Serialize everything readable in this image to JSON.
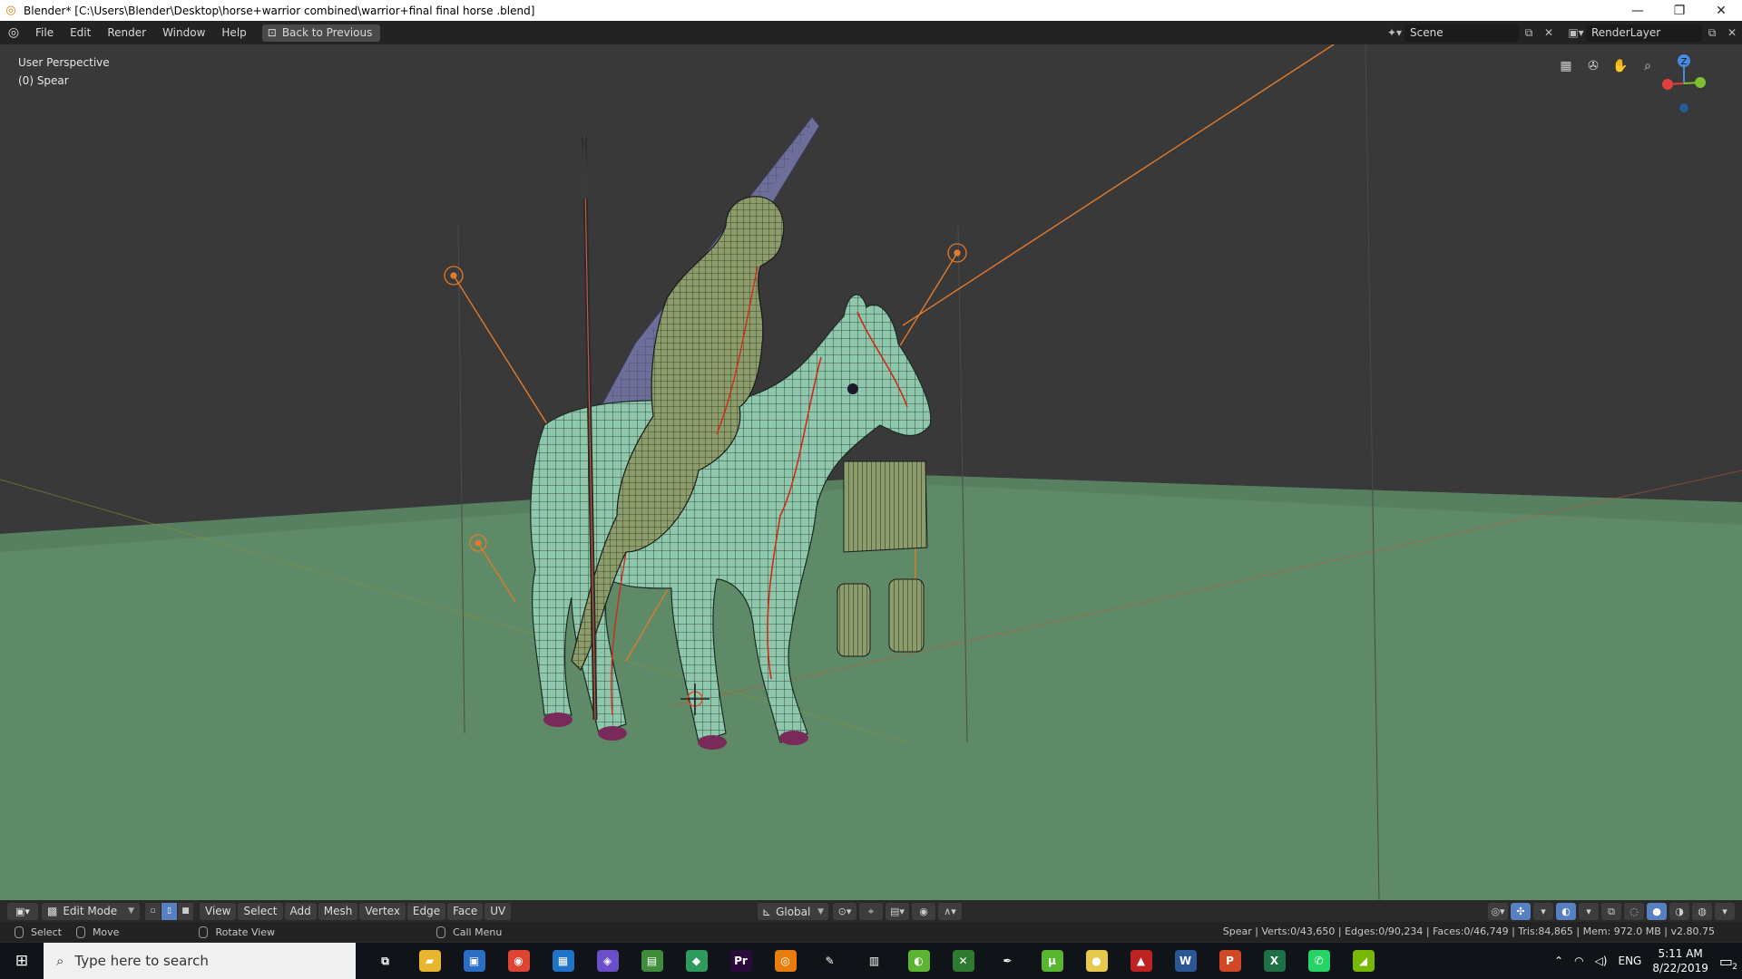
{
  "window": {
    "title": "Blender* [C:\\Users\\Blender\\Desktop\\horse+warrior combined\\warrior+final final horse .blend]",
    "minimize_icon": "minimize-icon",
    "restore_icon": "restore-icon",
    "close_icon": "close-icon"
  },
  "topbar": {
    "menus": [
      "File",
      "Edit",
      "Render",
      "Window",
      "Help"
    ],
    "back_label": "Back to Previous",
    "scene_name": "Scene",
    "render_layer": "RenderLayer"
  },
  "viewport": {
    "view_name": "User Perspective",
    "object_name": "(0) Spear",
    "colors": {
      "grid_floor": "#5e8a67",
      "background": "#393939",
      "mesh": "#8fc7ac",
      "wire": "#1a2a22",
      "seam": "#d12a1a",
      "light": "#e07a2e"
    },
    "axes": {
      "z": "Z"
    }
  },
  "header": {
    "mode": "Edit Mode",
    "menus": [
      "View",
      "Select",
      "Add",
      "Mesh",
      "Vertex",
      "Edge",
      "Face",
      "UV"
    ],
    "orientation": "Global"
  },
  "statusbar": {
    "select": "Select",
    "move": "Move",
    "rotate_view": "Rotate View",
    "call_menu": "Call Menu",
    "stats": "Spear | Verts:0/43,650 | Edges:0/90,234 | Faces:0/46,749 | Tris:84,865 | Mem: 972.0 MB | v2.80.75"
  },
  "taskbar": {
    "search_placeholder": "Type here to search",
    "language": "ENG",
    "time": "5:11 AM",
    "date": "8/22/2019",
    "notification_count": "2",
    "apps": [
      {
        "name": "task-view-icon",
        "glyph": "⧉",
        "bg": "transparent"
      },
      {
        "name": "file-explorer-icon",
        "glyph": "▰",
        "bg": "#e8b62c"
      },
      {
        "name": "store-icon",
        "glyph": "▣",
        "bg": "#2b6cc4"
      },
      {
        "name": "chrome-icon",
        "glyph": "◉",
        "bg": "#dd4433"
      },
      {
        "name": "calendar-app-icon",
        "glyph": "▦",
        "bg": "#1f74c7"
      },
      {
        "name": "teams-app-icon",
        "glyph": "◈",
        "bg": "#6a4fc8"
      },
      {
        "name": "photos-app-icon",
        "glyph": "▤",
        "bg": "#3f8c3a"
      },
      {
        "name": "vscode-icon",
        "glyph": "◆",
        "bg": "#2e9a5c"
      },
      {
        "name": "premiere-icon",
        "glyph": "Pr",
        "bg": "#2a0a3a"
      },
      {
        "name": "blender-icon",
        "glyph": "◎",
        "bg": "#e87d0d"
      },
      {
        "name": "tools-icon",
        "glyph": "✎",
        "bg": "transparent"
      },
      {
        "name": "calculator-icon",
        "glyph": "▥",
        "bg": "transparent"
      },
      {
        "name": "android-icon",
        "glyph": "◐",
        "bg": "#5cb531"
      },
      {
        "name": "xbox-icon",
        "glyph": "✕",
        "bg": "#2f7a31"
      },
      {
        "name": "pen-icon",
        "glyph": "✒",
        "bg": "transparent"
      },
      {
        "name": "utorrent-icon",
        "glyph": "µ",
        "bg": "#5ab531"
      },
      {
        "name": "coin-icon",
        "glyph": "●",
        "bg": "#e7c94b"
      },
      {
        "name": "amd-icon",
        "glyph": "▲",
        "bg": "#c02222"
      },
      {
        "name": "word-icon",
        "glyph": "W",
        "bg": "#2b5797"
      },
      {
        "name": "powerpoint-icon",
        "glyph": "P",
        "bg": "#d24726"
      },
      {
        "name": "excel-icon",
        "glyph": "X",
        "bg": "#1e7145"
      },
      {
        "name": "whatsapp-icon",
        "glyph": "✆",
        "bg": "#25d366"
      },
      {
        "name": "nvidia-icon",
        "glyph": "◢",
        "bg": "#76b900"
      }
    ]
  }
}
